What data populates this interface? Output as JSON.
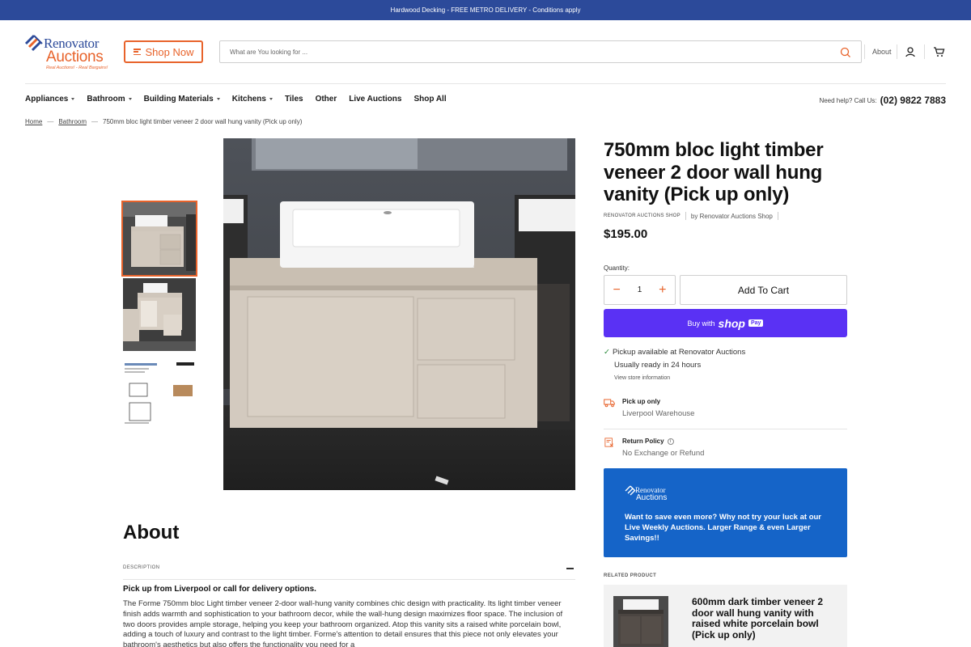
{
  "announcement": "Hardwood Decking - FREE METRO DELIVERY - Conditions apply",
  "logo": {
    "line1": "Renovator",
    "line2": "Auctions",
    "tagline": "Real Auctions! - Real Bargains!"
  },
  "shop_now_label": "Shop Now",
  "search": {
    "placeholder": "What are You looking for ..."
  },
  "header_links": {
    "about": "About"
  },
  "nav": {
    "items": [
      {
        "label": "Appliances",
        "has_menu": true
      },
      {
        "label": "Bathroom",
        "has_menu": true
      },
      {
        "label": "Building Materials",
        "has_menu": true
      },
      {
        "label": "Kitchens",
        "has_menu": true
      },
      {
        "label": "Tiles",
        "has_menu": false
      },
      {
        "label": "Other",
        "has_menu": false
      },
      {
        "label": "Live Auctions",
        "has_menu": false
      },
      {
        "label": "Shop All",
        "has_menu": false
      }
    ],
    "help_text": "Need help? Call Us:",
    "phone": "(02) 9822 7883"
  },
  "breadcrumb": {
    "home": "Home",
    "category": "Bathroom",
    "current": "750mm bloc light timber veneer 2 door wall hung vanity (Pick up only)"
  },
  "product": {
    "title": "750mm bloc light timber veneer 2 door wall hung vanity (Pick up only)",
    "shop_label": "RENOVATOR AUCTIONS SHOP",
    "vendor": "by Renovator Auctions Shop",
    "price": "$195.00",
    "quantity_label": "Quantity:",
    "quantity": "1",
    "add_to_cart": "Add To Cart",
    "shop_pay": {
      "prefix": "Buy with",
      "brand": "shop",
      "badge": "Pay"
    },
    "pickup_available": "Pickup available at Renovator Auctions",
    "ready_time": "Usually ready in 24 hours",
    "store_info": "View store information",
    "features": [
      {
        "icon": "truck-icon",
        "title": "Pick up only",
        "text": "Liverpool Warehouse"
      },
      {
        "icon": "return-policy-icon",
        "title": "Return Policy",
        "text": "No Exchange or Refund"
      }
    ]
  },
  "promo": {
    "text": "Want to save even more? Why not try your luck at our Live Weekly Auctions. Larger Range & even Larger Savings!!",
    "logo1": "Renovator",
    "logo2": "Auctions"
  },
  "related": {
    "label": "RELATED PRODUCT",
    "title": "600mm dark timber veneer 2 door wall hung vanity with raised white porcelain bowl (Pick up only)"
  },
  "about": {
    "heading": "About",
    "description_label": "DESCRIPTION",
    "lead": "Pick up from Liverpool or call for delivery options.",
    "body": "The Forme 750mm bloc Light timber veneer 2-door wall-hung vanity combines chic design with practicality. Its light timber veneer finish adds warmth and sophistication to your bathroom decor, while the wall-hung design maximizes floor space. The inclusion of two doors provides ample storage, helping you keep your bathroom organized. Atop this vanity sits a raised white porcelain bowl, adding a touch of luxury and contrast to the light timber. Forme's attention to detail ensures that this piece not only elevates your bathroom's aesthetics but also offers the functionality you need for a"
  },
  "colors": {
    "accent": "#e8632b",
    "brand_blue": "#2c4a9a",
    "shop_pay": "#5a31f4",
    "promo_blue": "#1564c8"
  }
}
